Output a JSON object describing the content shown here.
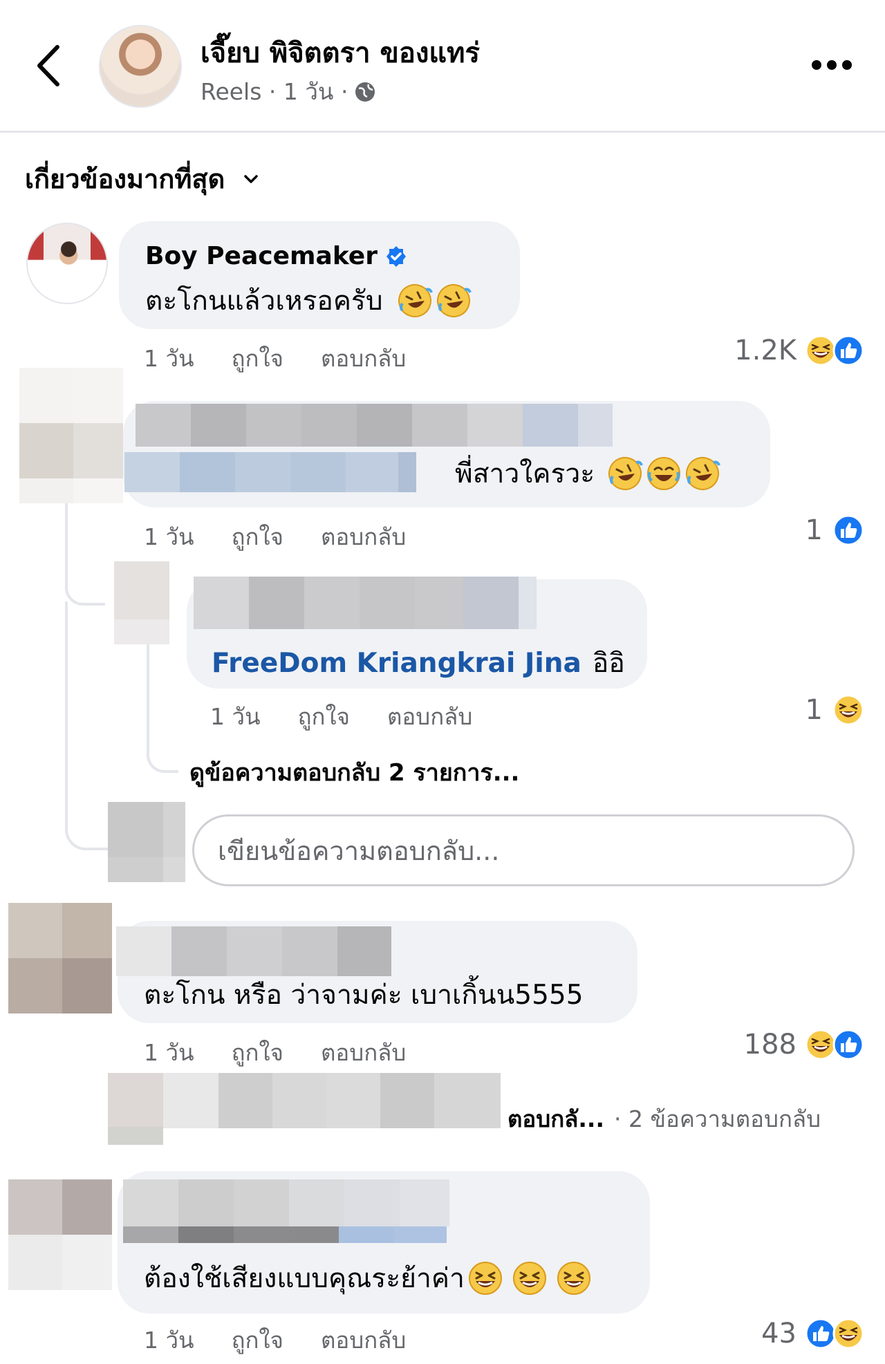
{
  "header": {
    "title": "เจี๊ยบ พิจิตตรา ของแทร่",
    "subtitle": "Reels · 1 วัน ·"
  },
  "sort": {
    "label": "เกี่ยวข้องมากที่สุด"
  },
  "comments": [
    {
      "author": "Boy Peacemaker",
      "verified": true,
      "text": "ตะโกนแล้วเหรอครับ",
      "time": "1 วัน",
      "like": "ถูกใจ",
      "reply": "ตอบกลับ",
      "reaction_count": "1.2K",
      "reactions": [
        "haha-icon",
        "like-icon"
      ]
    },
    {
      "author": "",
      "text": "พี่สาวใครวะ",
      "time": "1 วัน",
      "like": "ถูกใจ",
      "reply": "ตอบกลับ",
      "reaction_count": "1",
      "reactions": [
        "like-icon"
      ],
      "replies": [
        {
          "mention": "FreeDom Kriangkrai Jina",
          "text": "อิอิ",
          "time": "1 วัน",
          "like": "ถูกใจ",
          "reply": "ตอบกลับ",
          "reaction_count": "1",
          "reactions": [
            "haha-icon"
          ]
        }
      ],
      "view_more": "ดูข้อความตอบกลับ 2 รายการ...",
      "reply_placeholder": "เขียนข้อความตอบกลับ..."
    },
    {
      "author": "",
      "text": "ตะโกน หรือ ว่าจามค่ะ เบาเกิ้นน5555",
      "time": "1 วัน",
      "like": "ถูกใจ",
      "reply": "ตอบกลับ",
      "reaction_count": "188",
      "reactions": [
        "haha-icon",
        "like-icon"
      ],
      "reply_preview": "ตอบกลั...",
      "reply_count": "· 2 ข้อความตอบกลับ"
    },
    {
      "author": "",
      "text": "ต้องใช้เสียงแบบคุณระย้าค่า",
      "time": "1 วัน",
      "like": "ถูกใจ",
      "reply": "ตอบกลับ",
      "reaction_count": "43",
      "reactions": [
        "like-icon",
        "haha-icon"
      ]
    }
  ],
  "colors": {
    "like_blue": "#1877f2",
    "link_blue": "#1b57a6",
    "bubble": "#f0f2f5",
    "meta_gray": "#65676b"
  }
}
